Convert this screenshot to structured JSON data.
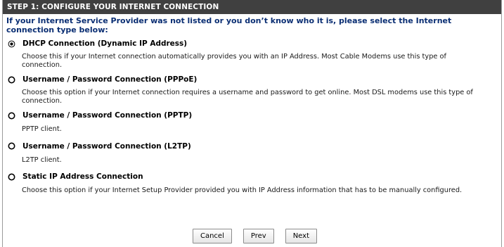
{
  "header": {
    "title": "STEP 1: CONFIGURE YOUR INTERNET CONNECTION"
  },
  "intro": {
    "text": "If your Internet Service Provider was not listed or you don’t know who it is, please select the Internet connection type below:"
  },
  "options": [
    {
      "label": "DHCP Connection (Dynamic IP Address)",
      "description": "Choose this if your Internet connection automatically provides you with an IP Address. Most Cable Modems use this type of connection.",
      "selected": true
    },
    {
      "label": "Username / Password Connection (PPPoE)",
      "description": "Choose this option if your Internet connection requires a username and password to get online. Most DSL modems use this type of connection.",
      "selected": false
    },
    {
      "label": "Username / Password Connection (PPTP)",
      "description": "PPTP client.",
      "selected": false
    },
    {
      "label": "Username / Password Connection (L2TP)",
      "description": "L2TP client.",
      "selected": false
    },
    {
      "label": "Static IP Address Connection",
      "description": "Choose this option if your Internet Setup Provider provided you with IP Address information that has to be manually configured.",
      "selected": false
    }
  ],
  "buttons": {
    "cancel": "Cancel",
    "prev": "Prev",
    "next": "Next"
  },
  "colors": {
    "header_bg": "#404040",
    "intro_text": "#0a2e73"
  }
}
